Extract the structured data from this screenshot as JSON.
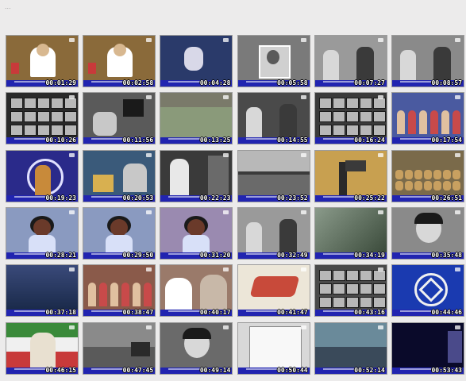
{
  "header": {
    "text": "... "
  },
  "thumbnails": [
    {
      "time": "00:01:29",
      "bg": "#8a6a3a",
      "scene": "anchor"
    },
    {
      "time": "00:02:58",
      "bg": "#8a6a3a",
      "scene": "anchor"
    },
    {
      "time": "00:04:28",
      "bg": "#2a3a6a",
      "scene": "figure-light"
    },
    {
      "time": "00:05:58",
      "bg": "#7a7a7a",
      "scene": "bw-portrait"
    },
    {
      "time": "00:07:27",
      "bg": "#9a9a9a",
      "scene": "bw-group"
    },
    {
      "time": "00:08:57",
      "bg": "#8a8a8a",
      "scene": "bw-group"
    },
    {
      "time": "00:10:26",
      "bg": "#2a2a2a",
      "scene": "monitors"
    },
    {
      "time": "00:11:56",
      "bg": "#5a5a5a",
      "scene": "bw-studio"
    },
    {
      "time": "00:13:25",
      "bg": "#7a7a6a",
      "scene": "field"
    },
    {
      "time": "00:14:55",
      "bg": "#4a4a4a",
      "scene": "bw-group"
    },
    {
      "time": "00:16:24",
      "bg": "#3a3a3a",
      "scene": "monitors"
    },
    {
      "time": "00:17:54",
      "bg": "#4a5aa0",
      "scene": "crowd-red"
    },
    {
      "time": "00:19:23",
      "bg": "#2a2a8a",
      "scene": "singer"
    },
    {
      "time": "00:20:53",
      "bg": "#3a5a7a",
      "scene": "band"
    },
    {
      "time": "00:22:23",
      "bg": "#3a3a3a",
      "scene": "bw-figure"
    },
    {
      "time": "00:23:52",
      "bg": "#b8b8b8",
      "scene": "parade"
    },
    {
      "time": "00:25:22",
      "bg": "#c8a050",
      "scene": "camera"
    },
    {
      "time": "00:26:51",
      "bg": "#7a6a4a",
      "scene": "crowd-brown"
    },
    {
      "time": "00:28:21",
      "bg": "#8a9ac0",
      "scene": "portrait-purple"
    },
    {
      "time": "00:29:50",
      "bg": "#8a9ac0",
      "scene": "portrait-purple"
    },
    {
      "time": "00:31:20",
      "bg": "#9a8ab0",
      "scene": "portrait-purple"
    },
    {
      "time": "00:32:49",
      "bg": "#9a9a9a",
      "scene": "bw-group"
    },
    {
      "time": "00:34:19",
      "bg": "#5a6a5a",
      "scene": "greenhouse"
    },
    {
      "time": "00:35:48",
      "bg": "#8a8a8a",
      "scene": "bw-face"
    },
    {
      "time": "00:37:18",
      "bg": "#2a3a5a",
      "scene": "dark-blue"
    },
    {
      "time": "00:38:47",
      "bg": "#8a5a4a",
      "scene": "crowd-red"
    },
    {
      "time": "00:40:17",
      "bg": "#9a7a6a",
      "scene": "two-figures"
    },
    {
      "time": "00:41:47",
      "bg": "#ece6d8",
      "scene": "logo-3d"
    },
    {
      "time": "00:43:16",
      "bg": "#4a4a4a",
      "scene": "monitors"
    },
    {
      "time": "00:44:46",
      "bg": "#1a3ab0",
      "scene": "star-logo"
    },
    {
      "time": "00:46:15",
      "bg": "#3a7a3a",
      "scene": "flag-portrait"
    },
    {
      "time": "00:47:45",
      "bg": "#8a8a8a",
      "scene": "bw-street"
    },
    {
      "time": "00:49:14",
      "bg": "#6a6a6a",
      "scene": "bw-face"
    },
    {
      "time": "00:50:44",
      "bg": "#d8d8d8",
      "scene": "document"
    },
    {
      "time": "00:52:14",
      "bg": "#4a6a7a",
      "scene": "control-room"
    },
    {
      "time": "00:53:43",
      "bg": "#0a0a2a",
      "scene": "space-text"
    }
  ]
}
